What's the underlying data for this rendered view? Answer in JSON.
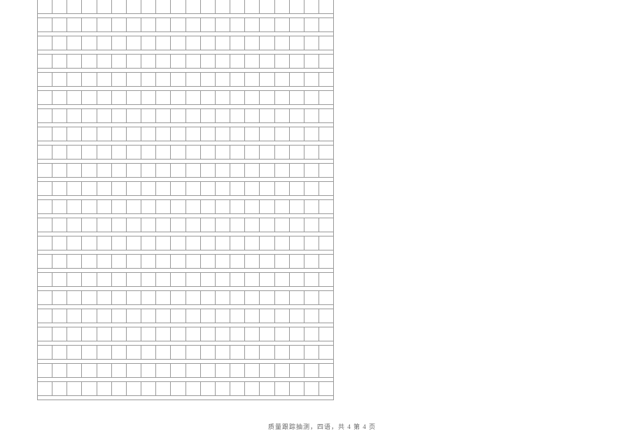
{
  "grid": {
    "rows": 22,
    "columns": 20
  },
  "footer": {
    "text": "质量跟踪抽测，四语，共 4 第 4 页"
  }
}
